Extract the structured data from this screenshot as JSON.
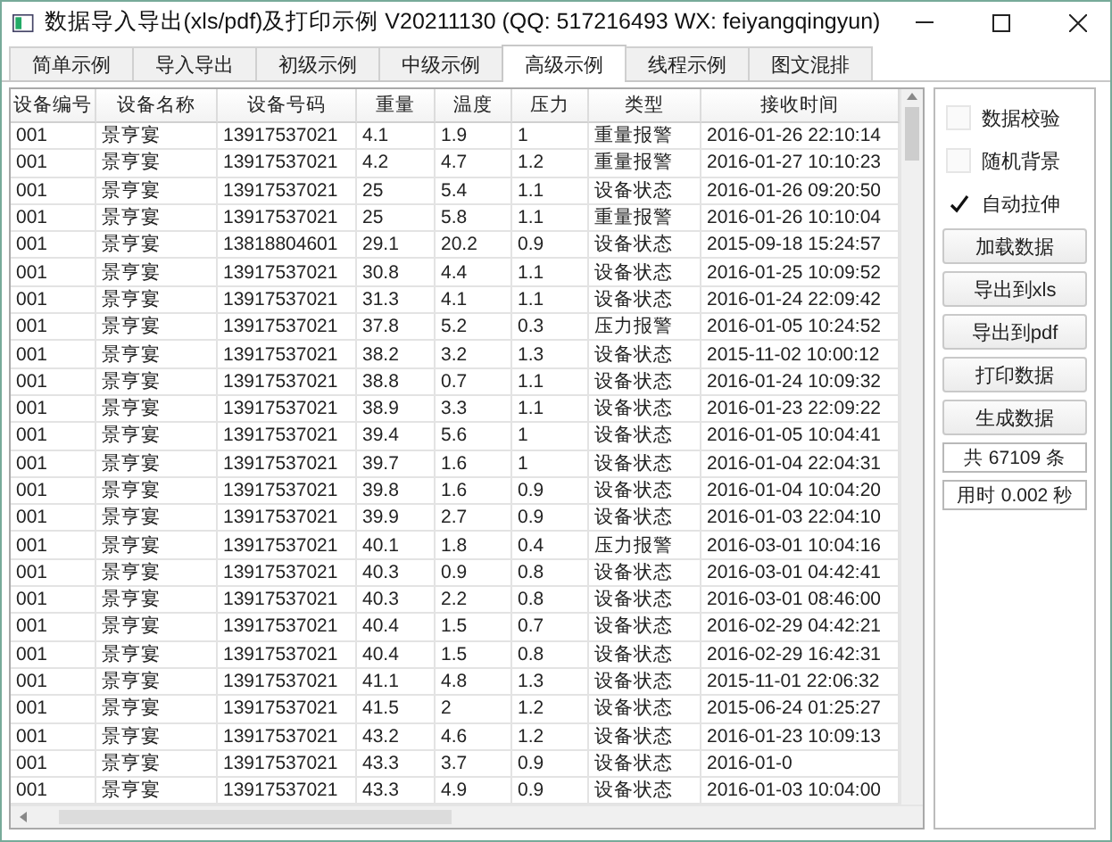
{
  "window": {
    "title": "数据导入导出(xls/pdf)及打印示例 V20211130 (QQ: 517216493 WX: feiyangqingyun)"
  },
  "tabs": [
    {
      "label": "简单示例",
      "selected": false
    },
    {
      "label": "导入导出",
      "selected": false
    },
    {
      "label": "初级示例",
      "selected": false
    },
    {
      "label": "中级示例",
      "selected": false
    },
    {
      "label": "高级示例",
      "selected": true
    },
    {
      "label": "线程示例",
      "selected": false
    },
    {
      "label": "图文混排",
      "selected": false
    }
  ],
  "table": {
    "columns": [
      "设备编号",
      "设备名称",
      "设备号码",
      "重量",
      "温度",
      "压力",
      "类型",
      "接收时间"
    ],
    "rows": [
      [
        "001",
        "景亨宴",
        "13917537021",
        "4.1",
        "1.9",
        "1",
        "重量报警",
        "2016-01-26 22:10:14"
      ],
      [
        "001",
        "景亨宴",
        "13917537021",
        "4.2",
        "4.7",
        "1.2",
        "重量报警",
        "2016-01-27 10:10:23"
      ],
      [
        "001",
        "景亨宴",
        "13917537021",
        "25",
        "5.4",
        "1.1",
        "设备状态",
        "2016-01-26 09:20:50"
      ],
      [
        "001",
        "景亨宴",
        "13917537021",
        "25",
        "5.8",
        "1.1",
        "重量报警",
        "2016-01-26 10:10:04"
      ],
      [
        "001",
        "景亨宴",
        "13818804601",
        "29.1",
        "20.2",
        "0.9",
        "设备状态",
        "2015-09-18 15:24:57"
      ],
      [
        "001",
        "景亨宴",
        "13917537021",
        "30.8",
        "4.4",
        "1.1",
        "设备状态",
        "2016-01-25 10:09:52"
      ],
      [
        "001",
        "景亨宴",
        "13917537021",
        "31.3",
        "4.1",
        "1.1",
        "设备状态",
        "2016-01-24 22:09:42"
      ],
      [
        "001",
        "景亨宴",
        "13917537021",
        "37.8",
        "5.2",
        "0.3",
        "压力报警",
        "2016-01-05 10:24:52"
      ],
      [
        "001",
        "景亨宴",
        "13917537021",
        "38.2",
        "3.2",
        "1.3",
        "设备状态",
        "2015-11-02 10:00:12"
      ],
      [
        "001",
        "景亨宴",
        "13917537021",
        "38.8",
        "0.7",
        "1.1",
        "设备状态",
        "2016-01-24 10:09:32"
      ],
      [
        "001",
        "景亨宴",
        "13917537021",
        "38.9",
        "3.3",
        "1.1",
        "设备状态",
        "2016-01-23 22:09:22"
      ],
      [
        "001",
        "景亨宴",
        "13917537021",
        "39.4",
        "5.6",
        "1",
        "设备状态",
        "2016-01-05 10:04:41"
      ],
      [
        "001",
        "景亨宴",
        "13917537021",
        "39.7",
        "1.6",
        "1",
        "设备状态",
        "2016-01-04 22:04:31"
      ],
      [
        "001",
        "景亨宴",
        "13917537021",
        "39.8",
        "1.6",
        "0.9",
        "设备状态",
        "2016-01-04 10:04:20"
      ],
      [
        "001",
        "景亨宴",
        "13917537021",
        "39.9",
        "2.7",
        "0.9",
        "设备状态",
        "2016-01-03 22:04:10"
      ],
      [
        "001",
        "景亨宴",
        "13917537021",
        "40.1",
        "1.8",
        "0.4",
        "压力报警",
        "2016-03-01 10:04:16"
      ],
      [
        "001",
        "景亨宴",
        "13917537021",
        "40.3",
        "0.9",
        "0.8",
        "设备状态",
        "2016-03-01 04:42:41"
      ],
      [
        "001",
        "景亨宴",
        "13917537021",
        "40.3",
        "2.2",
        "0.8",
        "设备状态",
        "2016-03-01 08:46:00"
      ],
      [
        "001",
        "景亨宴",
        "13917537021",
        "40.4",
        "1.5",
        "0.7",
        "设备状态",
        "2016-02-29 04:42:21"
      ],
      [
        "001",
        "景亨宴",
        "13917537021",
        "40.4",
        "1.5",
        "0.8",
        "设备状态",
        "2016-02-29 16:42:31"
      ],
      [
        "001",
        "景亨宴",
        "13917537021",
        "41.1",
        "4.8",
        "1.3",
        "设备状态",
        "2015-11-01 22:06:32"
      ],
      [
        "001",
        "景亨宴",
        "13917537021",
        "41.5",
        "2",
        "1.2",
        "设备状态",
        "2015-06-24 01:25:27"
      ],
      [
        "001",
        "景亨宴",
        "13917537021",
        "43.2",
        "4.6",
        "1.2",
        "设备状态",
        "2016-01-23 10:09:13"
      ],
      [
        "001",
        "景亨宴",
        "13917537021",
        "43.3",
        "3.7",
        "0.9",
        "设备状态",
        "2016-01-0"
      ],
      [
        "001",
        "景亨宴",
        "13917537021",
        "43.3",
        "4.9",
        "0.9",
        "设备状态",
        "2016-01-03 10:04:00"
      ]
    ]
  },
  "side_panel": {
    "items": [
      {
        "kind": "checkbox",
        "label": "数据校验",
        "checked": false
      },
      {
        "kind": "checkbox",
        "label": "随机背景",
        "checked": false
      },
      {
        "kind": "checkbox",
        "label": "自动拉伸",
        "checked": true
      },
      {
        "kind": "button",
        "label": "加载数据"
      },
      {
        "kind": "button",
        "label": "导出到xls"
      },
      {
        "kind": "button",
        "label": "导出到pdf"
      },
      {
        "kind": "button",
        "label": "打印数据"
      },
      {
        "kind": "button",
        "label": "生成数据"
      },
      {
        "kind": "label",
        "label": "共 67109 条"
      },
      {
        "kind": "label",
        "label": "用时 0.002 秒"
      }
    ]
  }
}
